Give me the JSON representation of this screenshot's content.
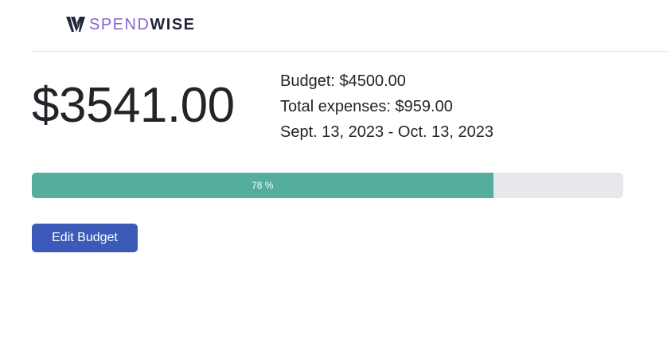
{
  "header": {
    "logo_icon": "spendwise-w-logo",
    "logo_text_part1": "SPEND",
    "logo_text_part2": "WISE"
  },
  "summary": {
    "remaining": "$3541.00",
    "budget": "Budget: $4500.00",
    "total_expenses": "Total expenses: $959.00",
    "period": "Sept. 13, 2023 - Oct. 13, 2023"
  },
  "progress": {
    "label": "78 %",
    "value": 0.78,
    "fill_color": "#55ae9d",
    "track_color": "#e7e8ec"
  },
  "actions": {
    "edit_budget_label": "Edit Budget",
    "button_color": "#3c5bb8"
  }
}
